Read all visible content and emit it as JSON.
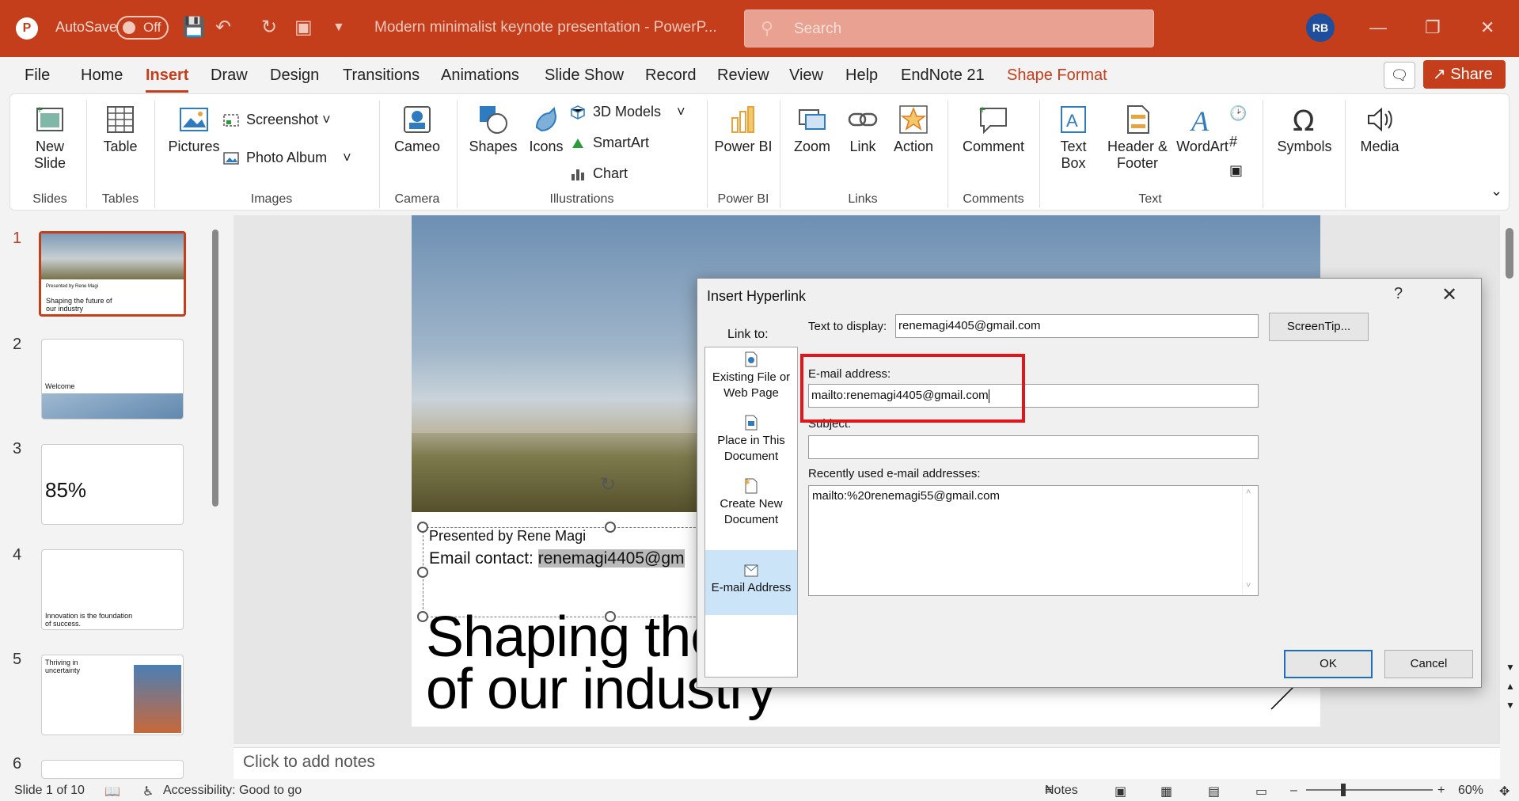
{
  "window": {
    "autosave_label": "AutoSave",
    "autosave_state": "Off",
    "doc_title": "Modern minimalist keynote presentation  -  PowerP...",
    "search_placeholder": "Search",
    "user_initials": "RB"
  },
  "menu": {
    "tabs": [
      "File",
      "Home",
      "Insert",
      "Draw",
      "Design",
      "Transitions",
      "Animations",
      "Slide Show",
      "Record",
      "Review",
      "View",
      "Help",
      "EndNote 21",
      "Shape Format"
    ],
    "active_tab": "Insert",
    "share_label": "Share"
  },
  "ribbon": {
    "new_slide": "New Slide",
    "table": "Table",
    "pictures": "Pictures",
    "screenshot": "Screenshot",
    "photo_album": "Photo Album",
    "cameo": "Cameo",
    "shapes": "Shapes",
    "icons": "Icons",
    "models_3d": "3D Models",
    "smartart": "SmartArt",
    "chart": "Chart",
    "power_bi": "Power BI",
    "zoom": "Zoom",
    "link": "Link",
    "action": "Action",
    "comment": "Comment",
    "text_box": "Text Box",
    "header_footer": "Header & Footer",
    "wordart": "WordArt",
    "symbols": "Symbols",
    "media": "Media",
    "groups": {
      "slides": "Slides",
      "tables": "Tables",
      "images": "Images",
      "camera": "Camera",
      "illustrations": "Illustrations",
      "power_bi": "Power BI",
      "links": "Links",
      "comments": "Comments",
      "text": "Text"
    }
  },
  "thumbnails": [
    {
      "num": "1",
      "text": "Shaping the future of our industry",
      "sub": "Presented by Rene Magi"
    },
    {
      "num": "2",
      "text": "Welcome"
    },
    {
      "num": "3",
      "text": "85%"
    },
    {
      "num": "4",
      "text": "Innovation is the foundation of success."
    },
    {
      "num": "5",
      "text": "Thriving in uncertainty"
    },
    {
      "num": "6",
      "text": ""
    }
  ],
  "slide": {
    "presented_by": "Presented by Rene Magi",
    "email_prefix": "Email contact: ",
    "email_value": "renemagi4405@gm",
    "headline_line1": "Shaping the",
    "headline_line2": "of our industry"
  },
  "notes_placeholder": "Click to add notes",
  "status": {
    "slide_count": "Slide 1 of 10",
    "accessibility": "Accessibility: Good to go",
    "notes": "Notes",
    "zoom": "60%"
  },
  "dialog": {
    "title": "Insert Hyperlink",
    "help": "?",
    "link_to": "Link to:",
    "link_options": [
      "Existing File or Web Page",
      "Place in This Document",
      "Create New Document",
      "E-mail Address"
    ],
    "selected_option": "E-mail Address",
    "text_to_display_label": "Text to display:",
    "text_to_display_value": "renemagi4405@gmail.com",
    "screentip": "ScreenTip...",
    "email_label": "E-mail address:",
    "email_value": "mailto:renemagi4405@gmail.com",
    "subject_label": "Subject:",
    "subject_value": "",
    "recent_label": "Recently used e-mail addresses:",
    "recent_items": [
      "mailto:%20renemagi55@gmail.com"
    ],
    "ok": "OK",
    "cancel": "Cancel"
  },
  "colors": {
    "accent": "#c43e1c",
    "highlight_box": "#e0161b",
    "selected_item": "#cce4f7"
  }
}
